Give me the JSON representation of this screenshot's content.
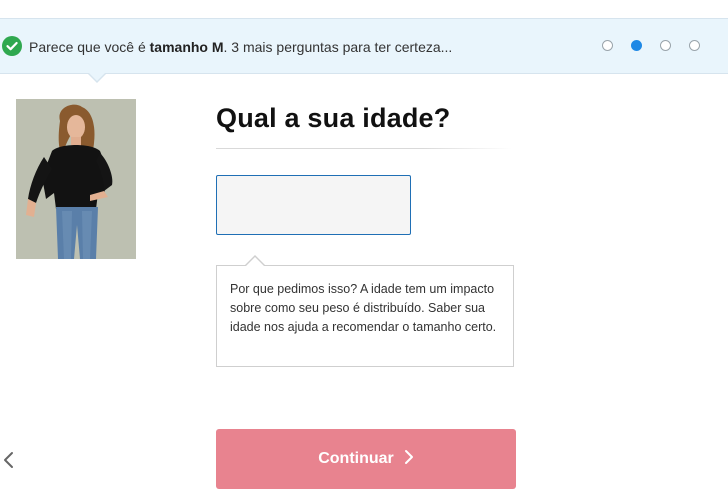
{
  "banner": {
    "prefix": "Parece que você é ",
    "size_bold": "tamanho M",
    "suffix": ". 3 mais perguntas para ter certeza...",
    "steps_total": 4,
    "active_step": 2,
    "icon": "check-circle-icon",
    "check_color": "#2fa84f",
    "active_dot_color": "#1e88e5"
  },
  "product": {
    "image_icon": "model-photo"
  },
  "question": {
    "title": "Qual a sua idade?"
  },
  "age_input": {
    "value": "",
    "placeholder": ""
  },
  "tooltip": {
    "text": "Por que pedimos isso? A idade tem um impacto sobre como seu peso é distribuído. Saber sua idade nos ajuda a recomendar o tamanho certo."
  },
  "navigation": {
    "back_icon": "chevron-left-icon",
    "continue_label": "Continuar",
    "continue_icon": "chevron-right-icon",
    "continue_color": "#e8838f"
  }
}
